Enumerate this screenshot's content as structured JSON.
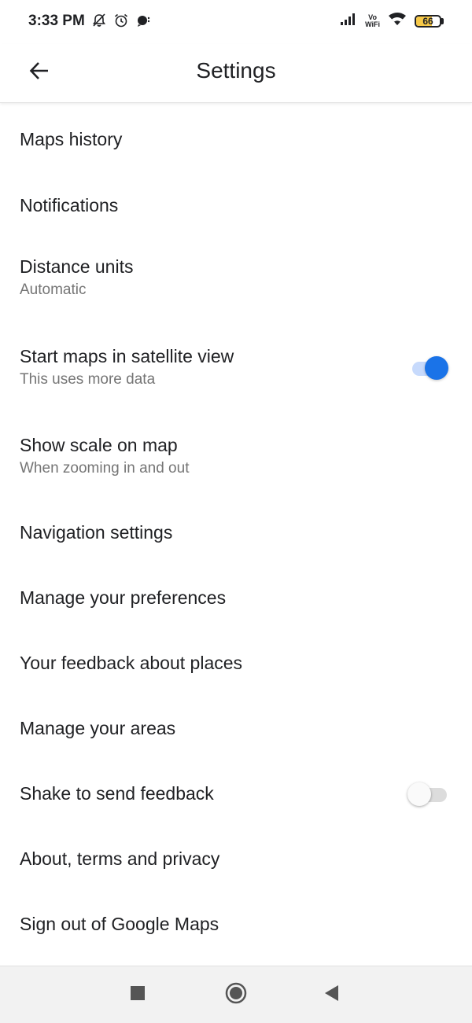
{
  "status_bar": {
    "time": "3:33 PM",
    "network_label_top": "Vo",
    "network_label_bottom": "WiFi",
    "battery_level": 66,
    "battery_label": "66"
  },
  "app_bar": {
    "title": "Settings",
    "back_icon": "arrow-left-icon"
  },
  "settings": {
    "items": [
      {
        "title": "Maps history"
      },
      {
        "title": "Notifications"
      },
      {
        "title": "Distance units",
        "subtitle": "Automatic"
      },
      {
        "title": "Start maps in satellite view",
        "subtitle": "This uses more data",
        "toggle": true
      },
      {
        "title": "Show scale on map",
        "subtitle": "When zooming in and out"
      },
      {
        "title": "Navigation settings"
      },
      {
        "title": "Manage your preferences"
      },
      {
        "title": "Your feedback about places"
      },
      {
        "title": "Manage your areas"
      },
      {
        "title": "Shake to send feedback",
        "toggle": false
      },
      {
        "title": "About, terms and privacy"
      },
      {
        "title": "Sign out of Google Maps"
      }
    ]
  },
  "colors": {
    "accent": "#1a73e8",
    "accent_track": "#c7dafc",
    "text_primary": "#202124",
    "text_secondary": "#757575",
    "battery_fill": "#f7c948"
  },
  "nav_bar": {
    "icons": [
      "square-recents-icon",
      "circle-home-icon",
      "triangle-back-icon"
    ]
  }
}
